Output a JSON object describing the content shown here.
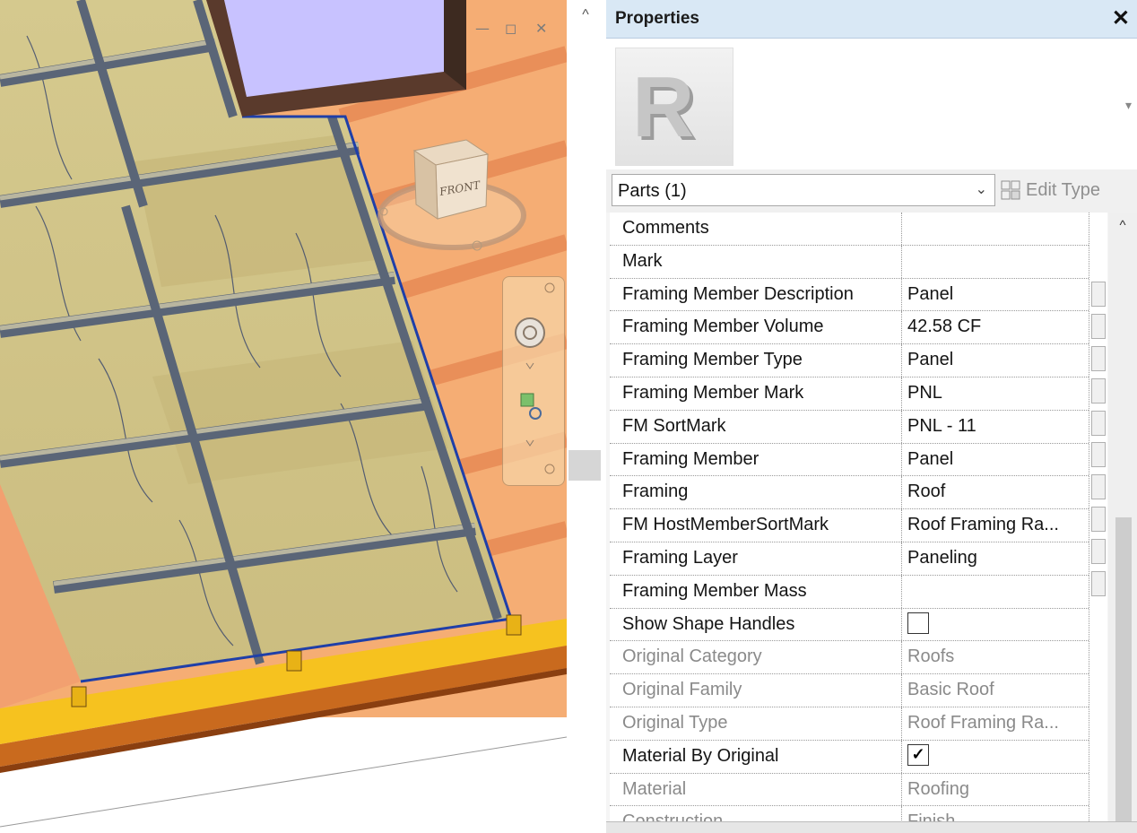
{
  "window_controls": {
    "minimize": "—",
    "restore": "◻",
    "close": "✕"
  },
  "viewcube": {
    "face_label": "FRONT"
  },
  "splitter": {
    "scroll_up_glyph": "^"
  },
  "properties": {
    "title": "Properties",
    "close_glyph": "✕",
    "type_image": "revit-logo-icon",
    "filter_label": "Parts (1)",
    "edit_type_label": "Edit Type",
    "rows": [
      {
        "name": "Comments",
        "value": ""
      },
      {
        "name": "Mark",
        "value": ""
      },
      {
        "name": "Framing Member Description",
        "value": "Panel"
      },
      {
        "name": "Framing Member Volume",
        "value": "42.58 CF"
      },
      {
        "name": "Framing Member Type",
        "value": "Panel"
      },
      {
        "name": "Framing Member Mark",
        "value": "PNL"
      },
      {
        "name": "FM SortMark",
        "value": "PNL - 11"
      },
      {
        "name": "Framing Member",
        "value": "Panel"
      },
      {
        "name": "Framing",
        "value": "Roof"
      },
      {
        "name": "FM HostMemberSortMark",
        "value": "Roof Framing Ra..."
      },
      {
        "name": "Framing Layer",
        "value": "Paneling"
      },
      {
        "name": "Framing Member Mass",
        "value": ""
      },
      {
        "name": "Show Shape Handles",
        "value": "",
        "checkbox": false
      },
      {
        "name": "Original Category",
        "value": "Roofs",
        "readonly": true
      },
      {
        "name": "Original Family",
        "value": "Basic Roof",
        "readonly": true
      },
      {
        "name": "Original Type",
        "value": "Roof Framing Ra...",
        "readonly": true
      },
      {
        "name": "Material By Original",
        "value": "",
        "checkbox": true
      },
      {
        "name": "Material",
        "value": "Roofing",
        "readonly": true
      },
      {
        "name": "Construction",
        "value": "Finish",
        "readonly": true
      }
    ]
  },
  "colors": {
    "header_bg": "#d9e8f5",
    "roof_orange": "#f4a460",
    "panel_tan": "#d8c98f",
    "selection_blue": "#1f3fa8"
  }
}
